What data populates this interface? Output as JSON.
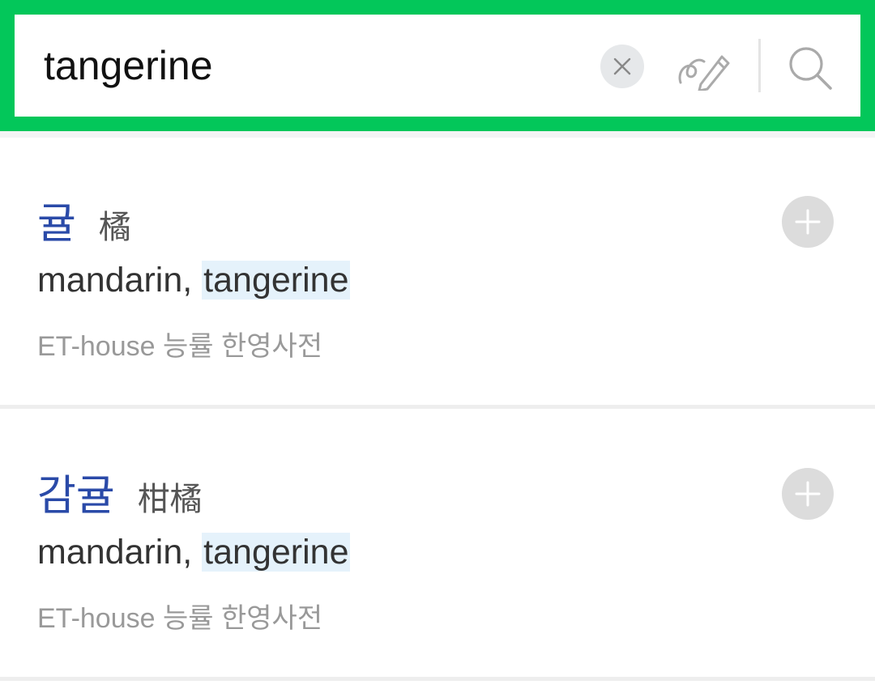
{
  "search": {
    "query": "tangerine",
    "clear_icon": "close-icon",
    "handwrite_icon": "handwriting-pen-icon",
    "search_icon": "search-icon"
  },
  "colors": {
    "brand_green": "#03c75a",
    "headword_blue": "#2a4aa8",
    "highlight": "#e5f2fb"
  },
  "results": [
    {
      "headword": "귤",
      "hanja": "橘",
      "meaning_prefix": "mandarin, ",
      "meaning_match": "tangerine",
      "source": "ET-house 능률 한영사전",
      "add_icon": "plus-icon"
    },
    {
      "headword": "감귤",
      "hanja": "柑橘",
      "meaning_prefix": "mandarin, ",
      "meaning_match": "tangerine",
      "source": "ET-house 능률 한영사전",
      "add_icon": "plus-icon"
    }
  ]
}
